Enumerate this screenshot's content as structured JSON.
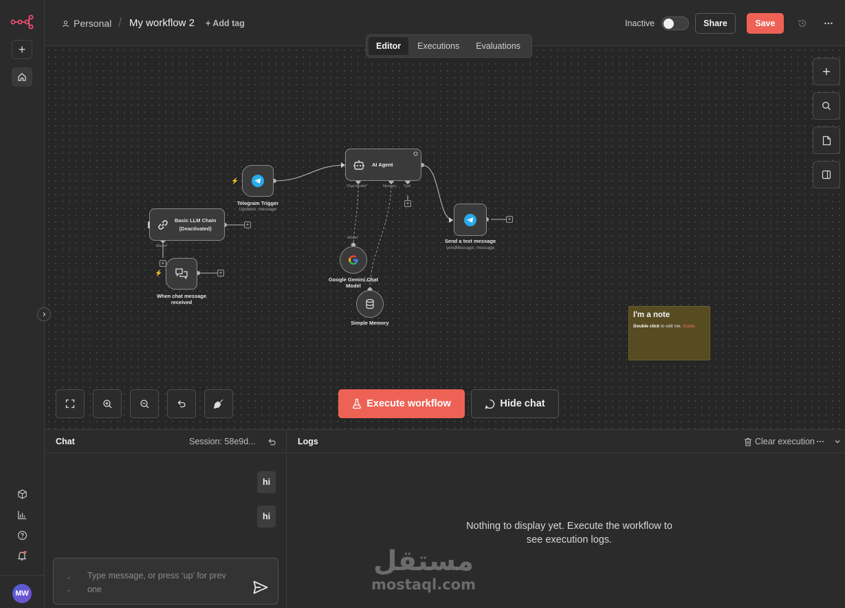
{
  "header": {
    "project": "Personal",
    "workflow_title": "My workflow 2",
    "add_tag": "+ Add tag",
    "status_label": "Inactive",
    "share_label": "Share",
    "save_label": "Save"
  },
  "tabs": [
    {
      "label": "Editor",
      "active": true
    },
    {
      "label": "Executions",
      "active": false
    },
    {
      "label": "Evaluations",
      "active": false
    }
  ],
  "nodes": {
    "telegram_trigger": {
      "title": "Telegram Trigger",
      "subtitle": "Updates: message"
    },
    "ai_agent": {
      "title": "AI Agent",
      "ports": {
        "chat_model": "Chat Model",
        "memory": "Memory",
        "tool": "Tool"
      }
    },
    "basic_llm_chain": {
      "title": "Basic LLM Chain",
      "subtitle": "(Deactivated)",
      "port": "Model"
    },
    "send_message": {
      "title": "Send a text message",
      "subtitle": "sendMessage: message"
    },
    "gemini": {
      "title_line1": "Google Gemini Chat",
      "title_line2": "Model",
      "port": "Model"
    },
    "memory": {
      "title": "Simple Memory",
      "port": "Memory"
    },
    "chat_trigger": {
      "title_line1": "When chat message",
      "title_line2": "received"
    }
  },
  "note": {
    "title": "I'm a note",
    "text_bold": "Double click",
    "text_rest": " to edit me. ",
    "guide": "Guide"
  },
  "canvas_actions": {
    "execute": "Execute workflow",
    "hide_chat": "Hide chat"
  },
  "chat": {
    "title": "Chat",
    "session": "Session: 58e9d...",
    "messages": [
      "hi",
      "hi"
    ],
    "input_placeholder": "Type message, or press ‘up’ for prev one"
  },
  "logs": {
    "title": "Logs",
    "clear_label": "Clear execution",
    "empty_text": "Nothing to display yet. Execute the workflow to see execution logs."
  },
  "user": {
    "initials": "MW"
  },
  "watermark": {
    "arabic": "مستقل",
    "latin": "mostaql.com"
  },
  "colors": {
    "accent": "#ee6256",
    "note": "#574b22",
    "telegram": "#29a9eb"
  }
}
